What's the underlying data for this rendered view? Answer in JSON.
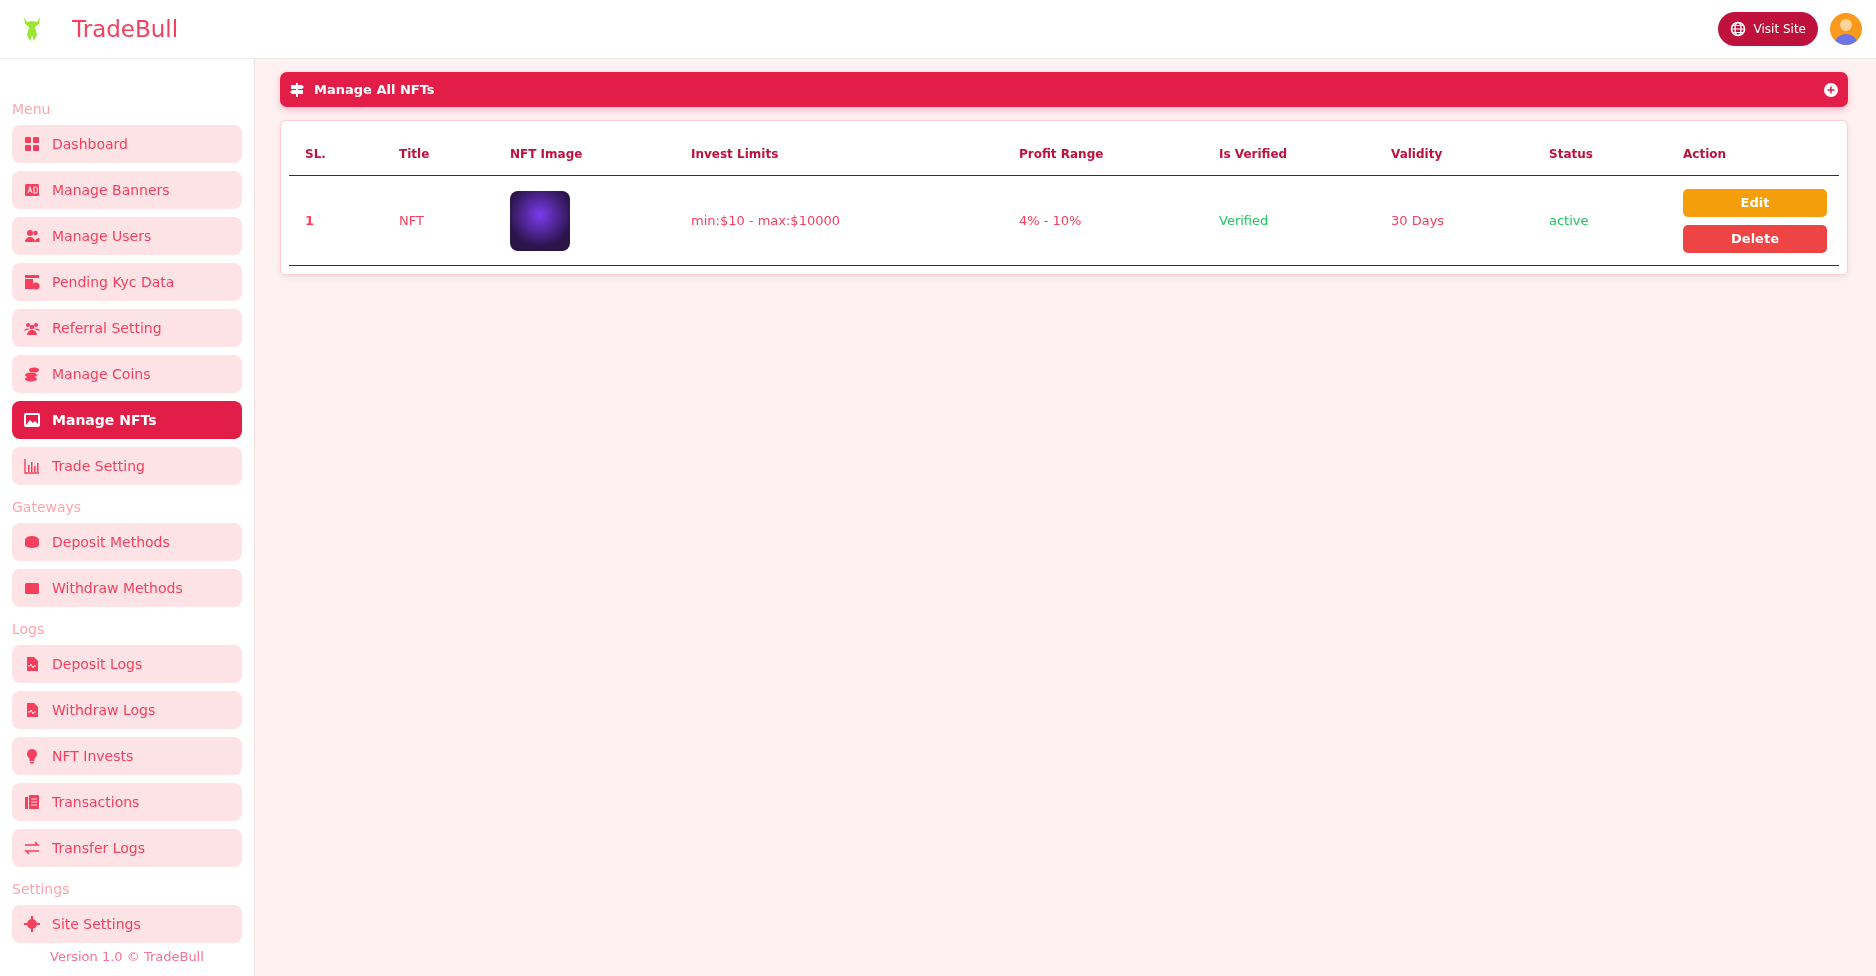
{
  "header": {
    "brand": "TradeBull",
    "visit_button": "Visit Site"
  },
  "sidebar": {
    "sections": [
      {
        "label": "Menu",
        "items": [
          {
            "label": "Dashboard",
            "selected": false
          },
          {
            "label": "Manage Banners",
            "selected": false
          },
          {
            "label": "Manage Users",
            "selected": false
          },
          {
            "label": "Pending Kyc Data",
            "selected": false
          },
          {
            "label": "Referral Setting",
            "selected": false
          },
          {
            "label": "Manage Coins",
            "selected": false
          },
          {
            "label": "Manage NFTs",
            "selected": true
          },
          {
            "label": "Trade Setting",
            "selected": false
          }
        ]
      },
      {
        "label": "Gateways",
        "items": [
          {
            "label": "Deposit Methods",
            "selected": false
          },
          {
            "label": "Withdraw Methods",
            "selected": false
          }
        ]
      },
      {
        "label": "Logs",
        "items": [
          {
            "label": "Deposit Logs",
            "selected": false
          },
          {
            "label": "Withdraw Logs",
            "selected": false
          },
          {
            "label": "NFT Invests",
            "selected": false
          },
          {
            "label": "Transactions",
            "selected": false
          },
          {
            "label": "Transfer Logs",
            "selected": false
          }
        ]
      },
      {
        "label": "Settings",
        "items": [
          {
            "label": "Site Settings",
            "selected": false
          }
        ]
      }
    ],
    "footer": "Version 1.0 © TradeBull"
  },
  "panel": {
    "title": "Manage All NFTs"
  },
  "table": {
    "columns": [
      "SL.",
      "Title",
      "NFT Image",
      "Invest Limits",
      "Profit Range",
      "Is Verified",
      "Validity",
      "Status",
      "Action"
    ],
    "rows": [
      {
        "sl": "1",
        "title": "NFT",
        "invest_limits": "min:$10 - max:$10000",
        "profit_range": "4% - 10%",
        "verified": "Verified",
        "validity": "30 Days",
        "status": "active",
        "actions": [
          "Edit",
          "Delete"
        ]
      }
    ]
  }
}
